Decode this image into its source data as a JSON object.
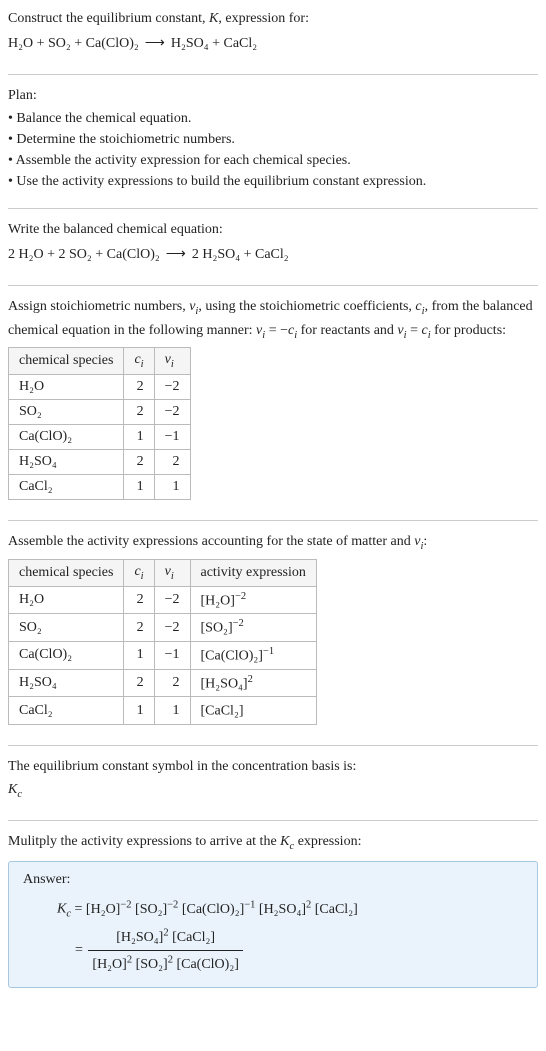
{
  "intro": {
    "line1_pre": "Construct the equilibrium constant, ",
    "line1_K": "K",
    "line1_post": ", expression for:",
    "eq_lhs": "H₂O + SO₂ + Ca(ClO)₂",
    "arrow": "⟶",
    "eq_rhs": "H₂SO₄ + CaCl₂"
  },
  "plan": {
    "heading": "Plan:",
    "items": [
      "• Balance the chemical equation.",
      "• Determine the stoichiometric numbers.",
      "• Assemble the activity expression for each chemical species.",
      "• Use the activity expressions to build the equilibrium constant expression."
    ]
  },
  "balanced": {
    "heading": "Write the balanced chemical equation:",
    "eq_lhs": "2 H₂O + 2 SO₂ + Ca(ClO)₂",
    "arrow": "⟶",
    "eq_rhs": "2 H₂SO₄ + CaCl₂"
  },
  "stoich": {
    "text_a": "Assign stoichiometric numbers, ",
    "nu": "ν",
    "sub_i": "i",
    "text_b": ", using the stoichiometric coefficients, ",
    "c": "c",
    "text_c": ", from the balanced chemical equation in the following manner: ",
    "rel1_lhs": "ν",
    "rel1_eq": " = −",
    "rel1_rhs": "c",
    "text_d": " for reactants and ",
    "rel2_lhs": "ν",
    "rel2_eq": " = ",
    "rel2_rhs": "c",
    "text_e": " for products:",
    "headers": [
      "chemical species",
      "cᵢ",
      "νᵢ"
    ],
    "rows": [
      {
        "sp": "H₂O",
        "c": "2",
        "v": "−2"
      },
      {
        "sp": "SO₂",
        "c": "2",
        "v": "−2"
      },
      {
        "sp": "Ca(ClO)₂",
        "c": "1",
        "v": "−1"
      },
      {
        "sp": "H₂SO₄",
        "c": "2",
        "v": "2"
      },
      {
        "sp": "CaCl₂",
        "c": "1",
        "v": "1"
      }
    ]
  },
  "activity": {
    "text_a": "Assemble the activity expressions accounting for the state of matter and ",
    "nu": "ν",
    "sub_i": "i",
    "text_b": ":",
    "headers": [
      "chemical species",
      "cᵢ",
      "νᵢ",
      "activity expression"
    ],
    "rows": [
      {
        "sp": "H₂O",
        "c": "2",
        "v": "−2",
        "expr_base": "[H₂O]",
        "expr_exp": "−2"
      },
      {
        "sp": "SO₂",
        "c": "2",
        "v": "−2",
        "expr_base": "[SO₂]",
        "expr_exp": "−2"
      },
      {
        "sp": "Ca(ClO)₂",
        "c": "1",
        "v": "−1",
        "expr_base": "[Ca(ClO)₂]",
        "expr_exp": "−1"
      },
      {
        "sp": "H₂SO₄",
        "c": "2",
        "v": "2",
        "expr_base": "[H₂SO₄]",
        "expr_exp": "2"
      },
      {
        "sp": "CaCl₂",
        "c": "1",
        "v": "1",
        "expr_base": "[CaCl₂]",
        "expr_exp": ""
      }
    ]
  },
  "symbol": {
    "text": "The equilibrium constant symbol in the concentration basis is:",
    "Kc": "K",
    "Kc_sub": "c"
  },
  "multiply": {
    "text_a": "Mulitply the activity expressions to arrive at the ",
    "Kc": "K",
    "Kc_sub": "c",
    "text_b": " expression:"
  },
  "answer": {
    "label": "Answer:",
    "Kc": "K",
    "Kc_sub": "c",
    "eq": " = ",
    "prod_terms": [
      {
        "base": "[H₂O]",
        "exp": "−2"
      },
      {
        "base": "[SO₂]",
        "exp": "−2"
      },
      {
        "base": "[Ca(ClO)₂]",
        "exp": "−1"
      },
      {
        "base": "[H₂SO₄]",
        "exp": "2"
      },
      {
        "base": "[CaCl₂]",
        "exp": ""
      }
    ],
    "frac_eq": "= ",
    "num_terms": [
      {
        "base": "[H₂SO₄]",
        "exp": "2"
      },
      {
        "base": "[CaCl₂]",
        "exp": ""
      }
    ],
    "den_terms": [
      {
        "base": "[H₂O]",
        "exp": "2"
      },
      {
        "base": "[SO₂]",
        "exp": "2"
      },
      {
        "base": "[Ca(ClO)₂]",
        "exp": ""
      }
    ]
  }
}
